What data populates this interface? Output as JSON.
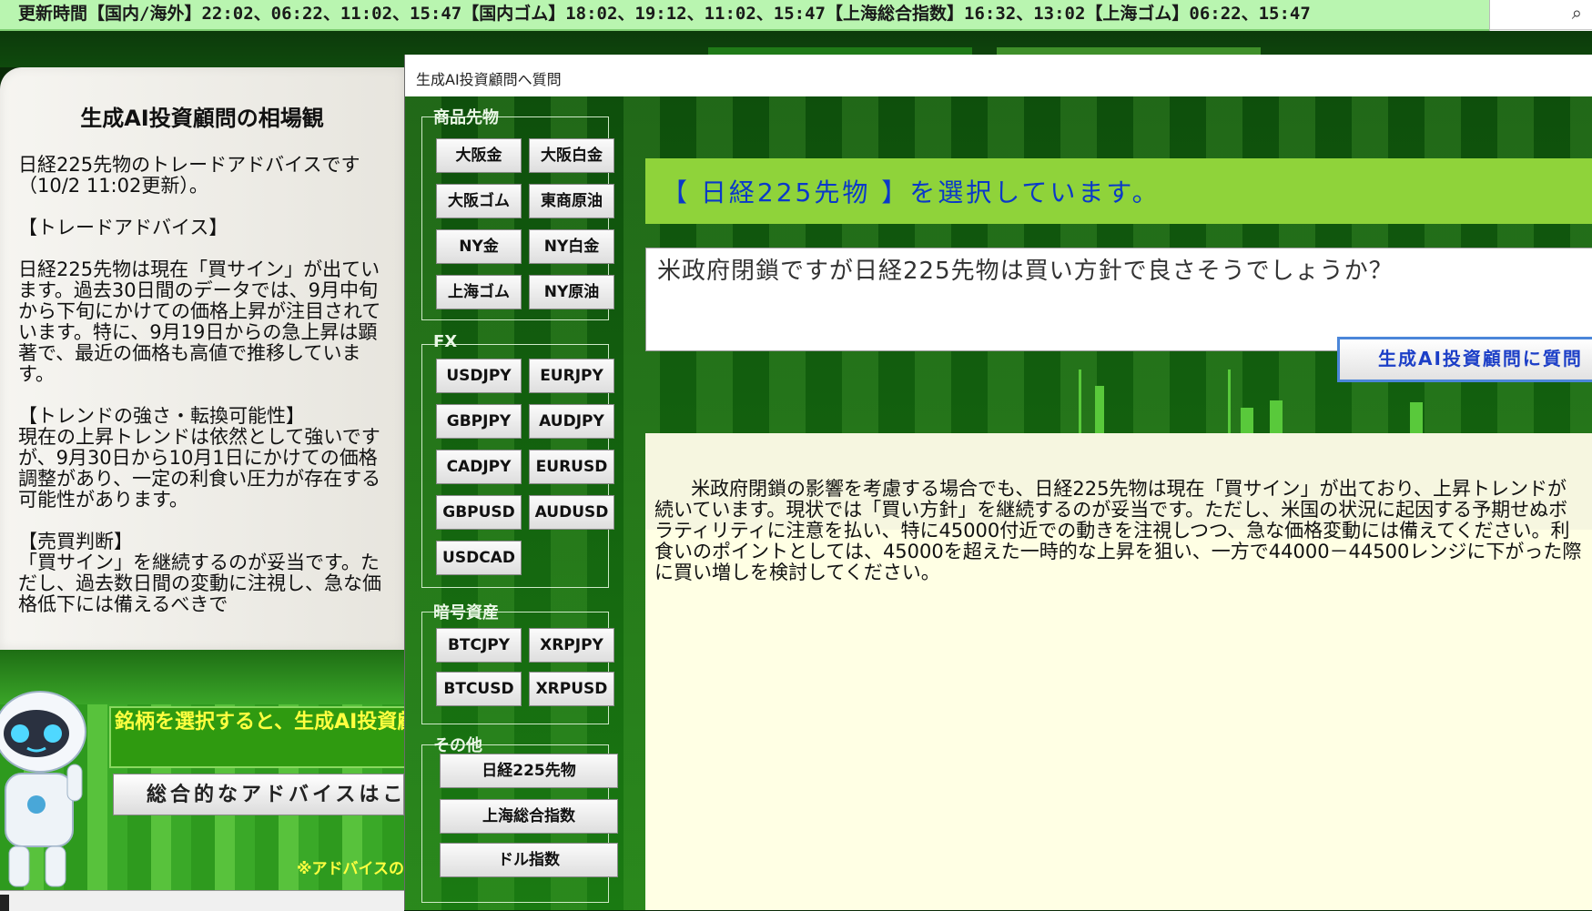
{
  "ticker": {
    "text": "更新時間【国内/海外】22:02、06:22、11:02、15:47【国内ゴム】18:02、19:12、11:02、15:47【上海総合指数】16:32、13:02【上海ゴム】06:22、15:47"
  },
  "advice_panel": {
    "title": "生成AI投資顧問の相場観",
    "body": "日経225先物のトレードアドバイスです（10/2 11:02更新）。\n\n【トレードアドバイス】\n\n日経225先物は現在「買サイン」が出ています。過去30日間のデータでは、9月中旬から下旬にかけての価格上昇が注目されています。特に、9月19日からの急上昇は顕著で、最近の価格も高値で推移しています。\n\n【トレンドの強さ・転換可能性】\n現在の上昇トレンドは依然として強いですが、9月30日から10月1日にかけての価格調整があり、一定の利食い圧力が存在する可能性があります。\n\n【売買判断】\n「買サイン」を継続するのが妥当です。ただし、過去数日間の変動に注視し、急な価格低下には備えるべきで"
  },
  "promo": {
    "notice": "銘柄を選択すると、生成AI投資顧問からのアドバイスが表示されます。",
    "overall_button": "総合的なアドバイスはこちら",
    "footnote": "※アドバイスの責任"
  },
  "dialog": {
    "title": "生成AI投資顧問へ質問",
    "groups": {
      "commodities": {
        "label": "商品先物",
        "buttons": [
          "大阪金",
          "大阪白金",
          "大阪ゴム",
          "東商原油",
          "NY金",
          "NY白金",
          "上海ゴム",
          "NY原油"
        ]
      },
      "fx": {
        "label": "FX",
        "buttons": [
          "USDJPY",
          "EURJPY",
          "GBPJPY",
          "AUDJPY",
          "CADJPY",
          "EURUSD",
          "GBPUSD",
          "AUDUSD",
          "USDCAD"
        ]
      },
      "crypto": {
        "label": "暗号資産",
        "buttons": [
          "BTCJPY",
          "XRPJPY",
          "BTCUSD",
          "XRPUSD"
        ]
      },
      "other": {
        "label": "その他",
        "buttons": [
          "日経225先物",
          "上海総合指数",
          "ドル指数"
        ]
      }
    },
    "selected_text": "【 日経225先物 】を選択しています。",
    "question": "米政府閉鎖ですが日経225先物は買い方針で良さそうでしょうか？",
    "ask_button": "生成AI投資顧問に質問",
    "answer": "米政府閉鎖の影響を考慮する場合でも、日経225先物は現在「買サイン」が出ており、上昇トレンドが続いています。現状では「買い方針」を継続するのが妥当です。ただし、米国の状況に起因する予期せぬボラティリティに注意を払い、特に45000付近での動きを注視しつつ、急な価格変動には備えてください。利食いのポイントとしては、45000を超えた一時的な上昇を狙い、一方で44000－44500レンジに下がった際に買い増しを検討してください。"
  },
  "colors": {
    "ticker_bg": "#b9f5b0",
    "selected_bar": "#8fd33a",
    "selected_text": "#0a39c9",
    "answer_bg": "#ffffe4",
    "promo_text": "#ffff40"
  }
}
